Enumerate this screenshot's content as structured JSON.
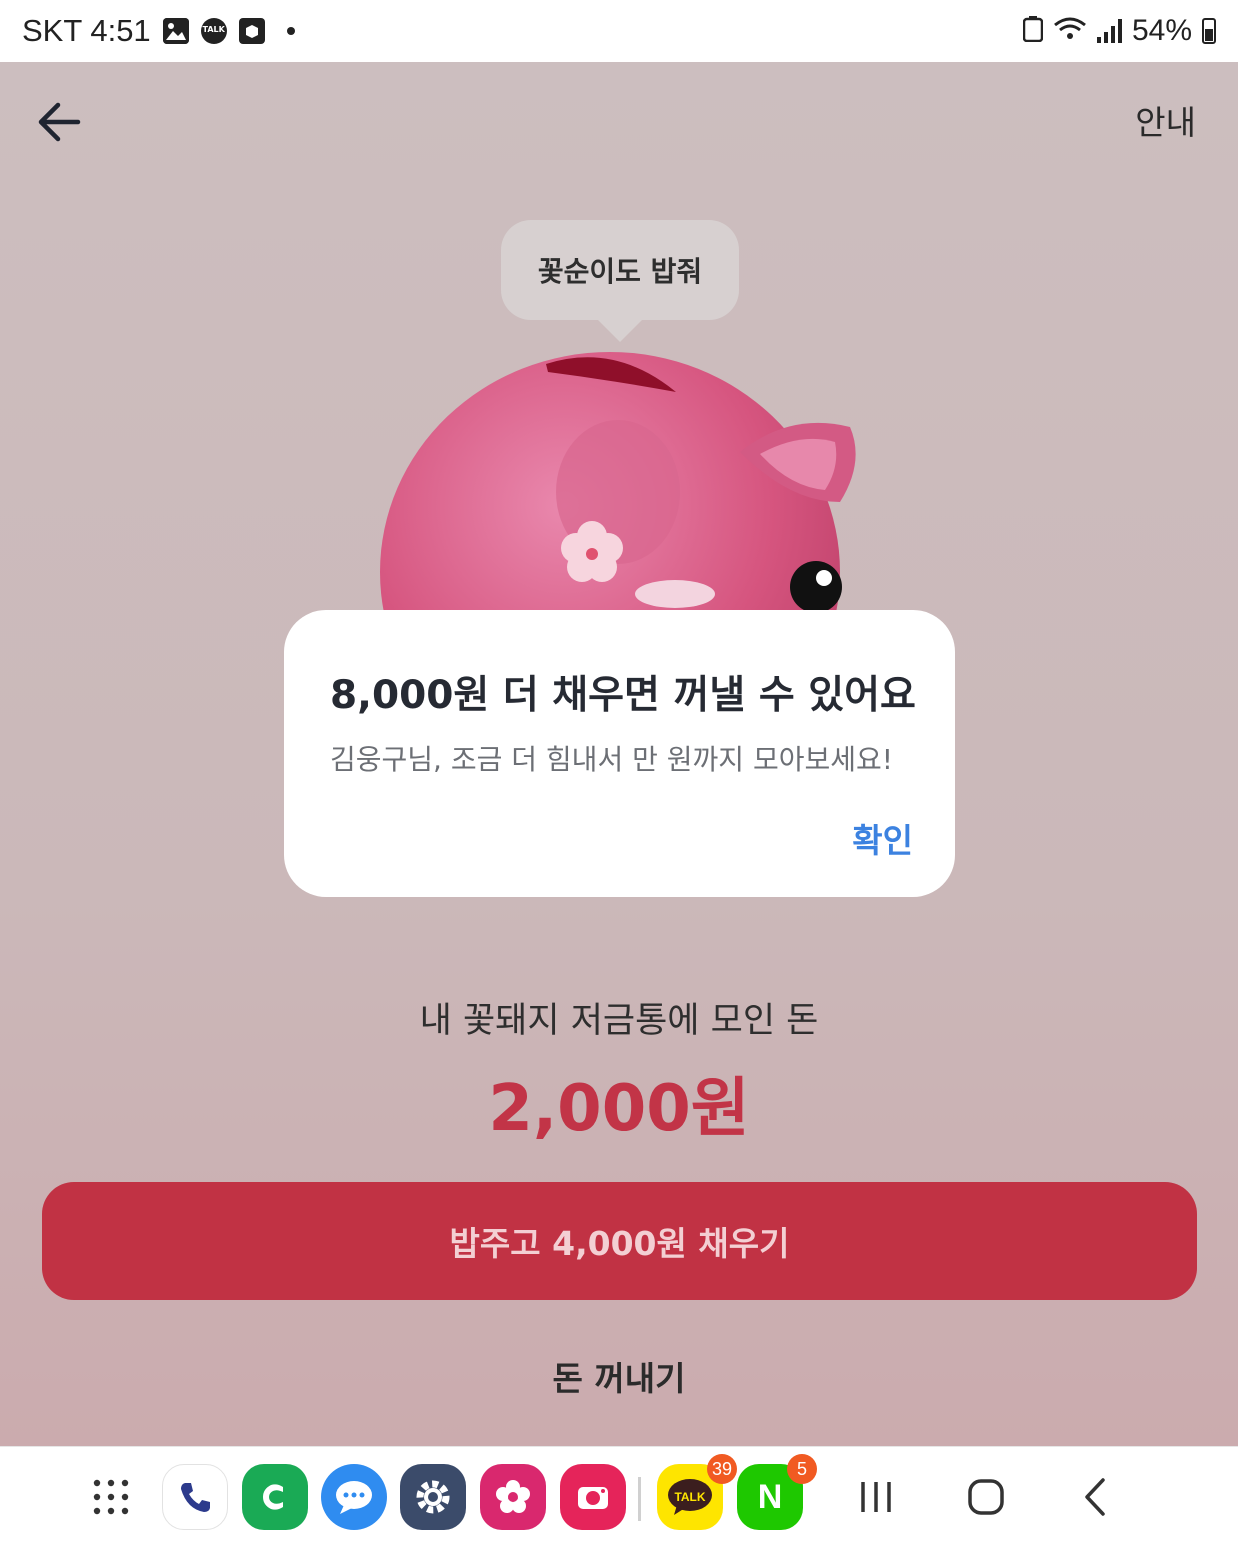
{
  "status_bar": {
    "carrier_time": "SKT 4:51",
    "notification_icons": [
      "gallery-icon",
      "kakaotalk-icon",
      "box-icon"
    ],
    "talk_mini": "TALK",
    "battery_percent": "54%"
  },
  "header": {
    "back_icon": "arrow-left-icon",
    "guide_label": "안내"
  },
  "bubble": {
    "text": "꽃순이도 밥줘"
  },
  "dialog": {
    "title": "8,000원 더 채우면 꺼낼 수 있어요",
    "body": "김웅구님, 조금 더 힘내서 만 원까지 모아보세요!",
    "confirm_label": "확인"
  },
  "savings": {
    "label": "내 꽃돼지 저금통에 모인 돈",
    "amount": "2,000원"
  },
  "actions": {
    "fill_button": "밥주고 4,000원 채우기",
    "withdraw_button": "돈 꺼내기"
  },
  "dock": {
    "apps": [
      {
        "name": "apps-grid-icon"
      },
      {
        "name": "phone-icon"
      },
      {
        "name": "line-c-icon"
      },
      {
        "name": "messages-icon"
      },
      {
        "name": "settings-icon"
      },
      {
        "name": "flower-app-icon"
      },
      {
        "name": "camera-icon"
      },
      {
        "name": "kakaotalk-icon",
        "badge": "39",
        "label": "TALK"
      },
      {
        "name": "naver-icon",
        "badge": "5",
        "label": "N"
      }
    ],
    "nav": [
      "recents-icon",
      "home-icon",
      "back-icon"
    ]
  },
  "colors": {
    "accent_red": "#c13244",
    "amount_red": "#c23447",
    "confirm_blue": "#3c82e0",
    "background": "#ccbebf"
  }
}
